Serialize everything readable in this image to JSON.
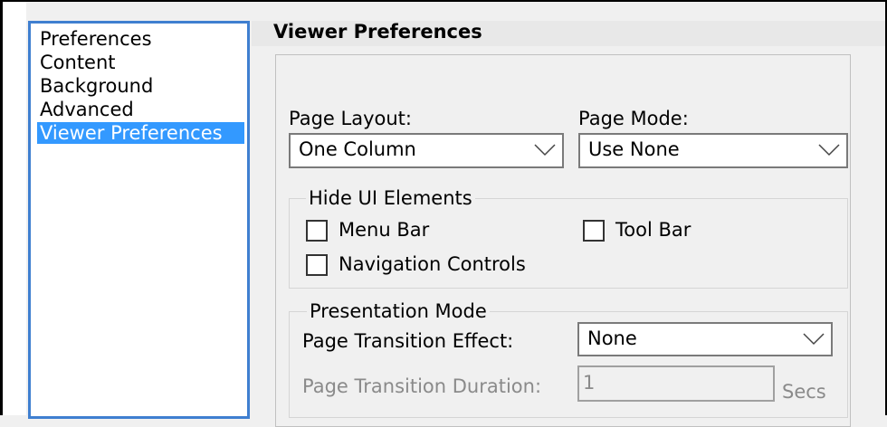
{
  "categories": [
    {
      "label": "Preferences",
      "selected": false
    },
    {
      "label": "Content",
      "selected": false
    },
    {
      "label": "Background",
      "selected": false
    },
    {
      "label": "Advanced",
      "selected": false
    },
    {
      "label": "Viewer Preferences",
      "selected": true
    }
  ],
  "panel": {
    "title": "Viewer Preferences"
  },
  "page_layout": {
    "label": "Page Layout:",
    "value": "One Column"
  },
  "page_mode": {
    "label": "Page Mode:",
    "value": "Use None"
  },
  "hide_ui": {
    "title": "Hide UI Elements",
    "menu_bar": {
      "label": "Menu Bar",
      "checked": false
    },
    "tool_bar": {
      "label": "Tool Bar",
      "checked": false
    },
    "navigation_controls": {
      "label": "Navigation Controls",
      "checked": false
    }
  },
  "presentation": {
    "title": "Presentation Mode",
    "transition_effect": {
      "label": "Page Transition Effect:",
      "value": "None"
    },
    "transition_duration": {
      "label": "Page Transition Duration:",
      "value": "1",
      "unit": "Secs"
    }
  },
  "colors": {
    "selection": "#3399ff",
    "list_border": "#3f7fd0"
  }
}
